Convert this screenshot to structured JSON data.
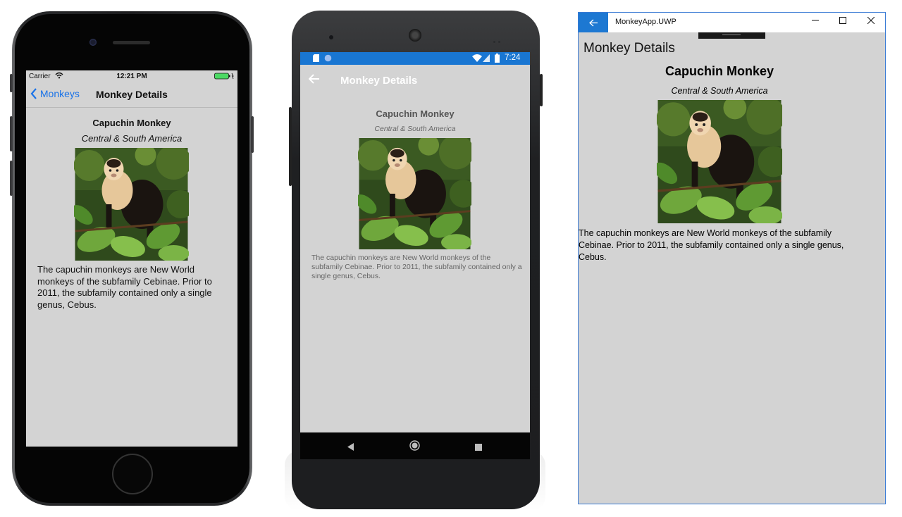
{
  "ios": {
    "status": {
      "carrier": "Carrier",
      "time": "12:21 PM"
    },
    "nav": {
      "back_label": "Monkeys",
      "title": "Monkey Details"
    },
    "monkey": {
      "name": "Capuchin Monkey",
      "location": "Central & South America",
      "details": "The capuchin monkeys are New World monkeys of the subfamily Cebinae. Prior to 2011, the subfamily contained only a single genus, Cebus."
    }
  },
  "android": {
    "status": {
      "time": "7:24"
    },
    "toolbar": {
      "title": "Monkey Details"
    },
    "monkey": {
      "name": "Capuchin Monkey",
      "location": "Central & South America",
      "details": "The capuchin monkeys are New World monkeys of the subfamily Cebinae. Prior to 2011, the subfamily contained only a single genus, Cebus."
    }
  },
  "uwp": {
    "window_title": "MonkeyApp.UWP",
    "page_title": "Monkey Details",
    "monkey": {
      "name": "Capuchin Monkey",
      "location": "Central & South America",
      "details": "The capuchin monkeys are New World monkeys of the subfamily Cebinae. Prior to 2011, the subfamily contained only a single genus, Cebus."
    }
  },
  "colors": {
    "page_background": "#d3d3d3",
    "ios_tint": "#1a73e8",
    "android_status": "#1976d2",
    "uwp_accent": "#1d78d2"
  },
  "icons": [
    "back-chevron-icon",
    "wifi-icon",
    "battery-icon",
    "signal-icon",
    "back-arrow-icon",
    "nav-back-icon",
    "nav-home-icon",
    "nav-recents-icon",
    "minimize-icon",
    "maximize-icon",
    "close-icon"
  ]
}
